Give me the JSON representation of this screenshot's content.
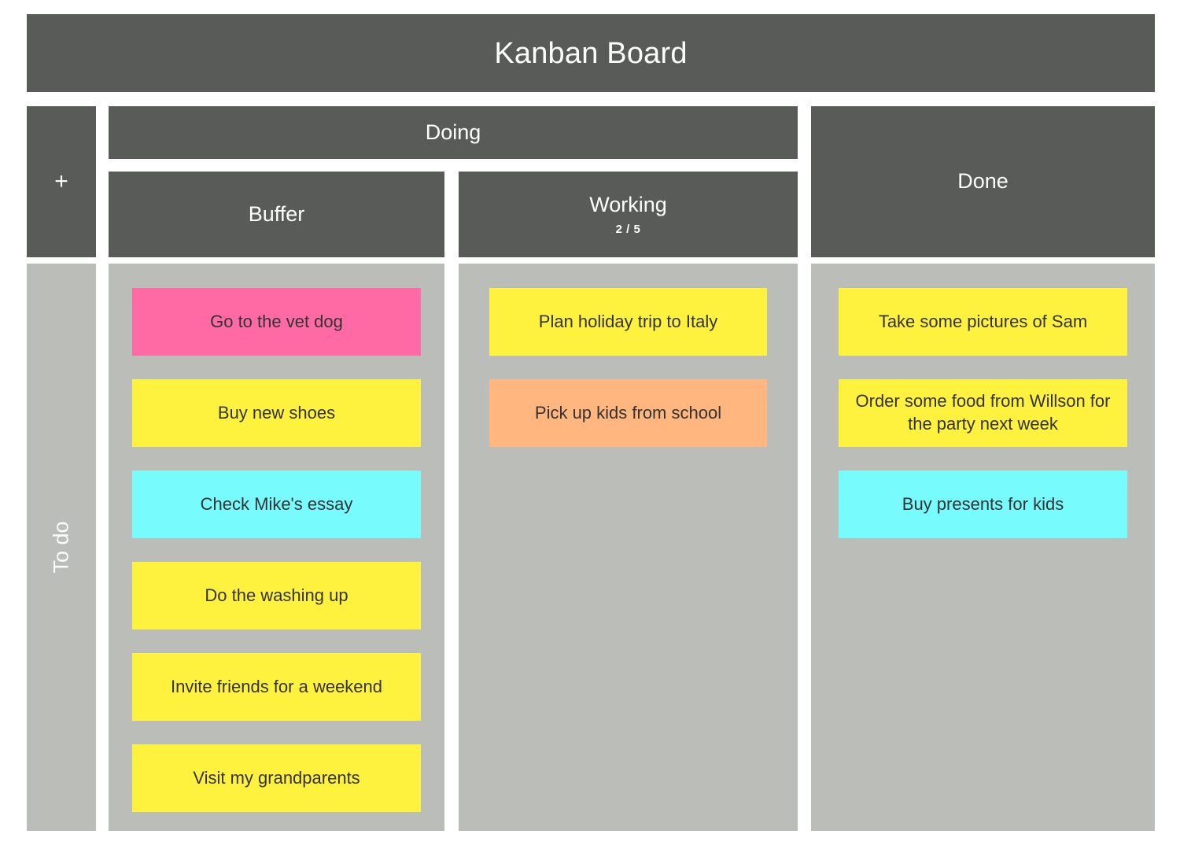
{
  "board": {
    "title": "Kanban Board",
    "colors": {
      "header_gray": "#595b59",
      "lane_gray": "#bbbdb8",
      "card_yellow": "#fff23e",
      "card_pink": "#ff6aa5",
      "card_cyan": "#78fbfd",
      "card_orange": "#ffb67f",
      "card_text": "#333333",
      "header_text": "#ffffff",
      "page_background": "#ffffff"
    },
    "add_column_button": {
      "label": "+",
      "icon": "plus-icon"
    },
    "swimlane": {
      "label": "To do",
      "orientation": "vertical"
    },
    "group_headers": [
      {
        "label": "Doing",
        "spans": [
          "Buffer",
          "Working"
        ]
      }
    ],
    "columns": [
      {
        "id": "buffer",
        "label": "Buffer",
        "parent": "Doing",
        "wip_limit": null,
        "cards": [
          {
            "text": "Go to the vet dog",
            "color": "#ff6aa5",
            "color_name": "pink"
          },
          {
            "text": "Buy new shoes",
            "color": "#fff23e",
            "color_name": "yellow"
          },
          {
            "text": "Check Mike's essay",
            "color": "#78fbfd",
            "color_name": "cyan"
          },
          {
            "text": "Do the washing up",
            "color": "#fff23e",
            "color_name": "yellow"
          },
          {
            "text": "Invite friends for a weekend",
            "color": "#fff23e",
            "color_name": "yellow"
          },
          {
            "text": "Visit my grandparents",
            "color": "#fff23e",
            "color_name": "yellow"
          }
        ]
      },
      {
        "id": "working",
        "label": "Working",
        "parent": "Doing",
        "wip_limit": "2 / 5",
        "cards": [
          {
            "text": "Plan holiday trip to Italy",
            "color": "#fff23e",
            "color_name": "yellow"
          },
          {
            "text": "Pick up kids from school",
            "color": "#ffb67f",
            "color_name": "orange"
          }
        ]
      },
      {
        "id": "done",
        "label": "Done",
        "parent": null,
        "wip_limit": null,
        "cards": [
          {
            "text": "Take some pictures of Sam",
            "color": "#fff23e",
            "color_name": "yellow"
          },
          {
            "text": "Order some food from Willson for the party next week",
            "color": "#fff23e",
            "color_name": "yellow"
          },
          {
            "text": "Buy presents for kids",
            "color": "#78fbfd",
            "color_name": "cyan"
          }
        ]
      }
    ]
  }
}
